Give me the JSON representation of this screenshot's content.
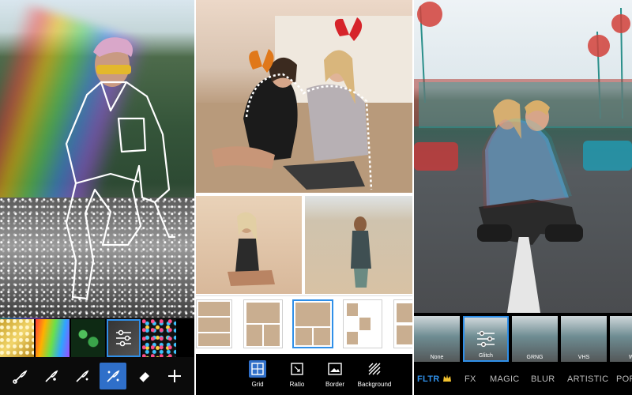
{
  "panel_layout": {
    "tools": [
      {
        "icon": "grid-icon",
        "label": "Grid"
      },
      {
        "icon": "ratio-icon",
        "label": "Ratio"
      },
      {
        "icon": "border-icon",
        "label": "Border"
      },
      {
        "icon": "background-icon",
        "label": "Background"
      }
    ],
    "active_tool": "Grid"
  },
  "panel_filters": {
    "thumbnails": [
      {
        "label": "None"
      },
      {
        "label": "Glitch"
      },
      {
        "label": "GRNG"
      },
      {
        "label": "VHS"
      },
      {
        "label": "Wa"
      }
    ],
    "selected_thumbnail": "Glitch",
    "tabs": [
      {
        "label": "FLTR"
      },
      {
        "label": "FX"
      },
      {
        "label": "MAGIC"
      },
      {
        "label": "BLUR"
      },
      {
        "label": "ARTISTIC"
      },
      {
        "label": "POP"
      }
    ],
    "active_tab": "FLTR",
    "premium_icon": "crown-icon"
  },
  "panel_sticker": {
    "brushes": [
      "rainbow",
      "clover",
      "adjust",
      "confetti"
    ],
    "tools": [
      {
        "icon": "brush-icon"
      },
      {
        "icon": "brush-small-icon"
      },
      {
        "icon": "magic-brush-icon"
      },
      {
        "icon": "sparkle-brush-icon"
      },
      {
        "icon": "eraser-icon"
      },
      {
        "icon": "plus-icon"
      }
    ],
    "active_tool": "sparkle-brush-icon"
  },
  "colors": {
    "accent": "#2f8fe8",
    "toolbar": "#000000"
  }
}
